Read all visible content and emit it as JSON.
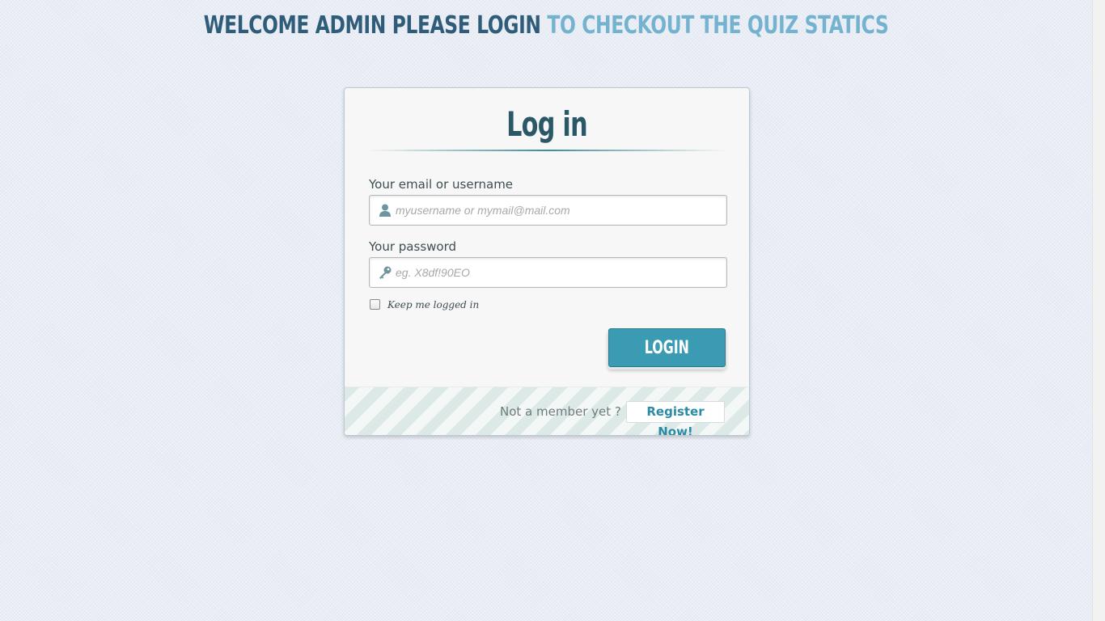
{
  "header": {
    "heading_dark": "Welcome Admin please login",
    "heading_light": "to checkout the Quiz Statics"
  },
  "login": {
    "title": "Log in",
    "username": {
      "label": "Your email or username",
      "placeholder": "myusername or mymail@mail.com",
      "value": "",
      "icon": "user-icon"
    },
    "password": {
      "label": "Your password",
      "placeholder": "eg. X8df!90EO",
      "value": "",
      "icon": "key-icon"
    },
    "keep_logged_in": {
      "label": "Keep me logged in",
      "checked": false
    },
    "submit_label": "Login",
    "footer": {
      "prompt": "Not a member yet ?",
      "register_label": "Register Now!"
    }
  },
  "colors": {
    "accent": "#3a9bb2",
    "heading_dark": "#2f5d79",
    "heading_light": "#74b3d0",
    "title": "#2a5867",
    "link": "#2b8aa6"
  }
}
